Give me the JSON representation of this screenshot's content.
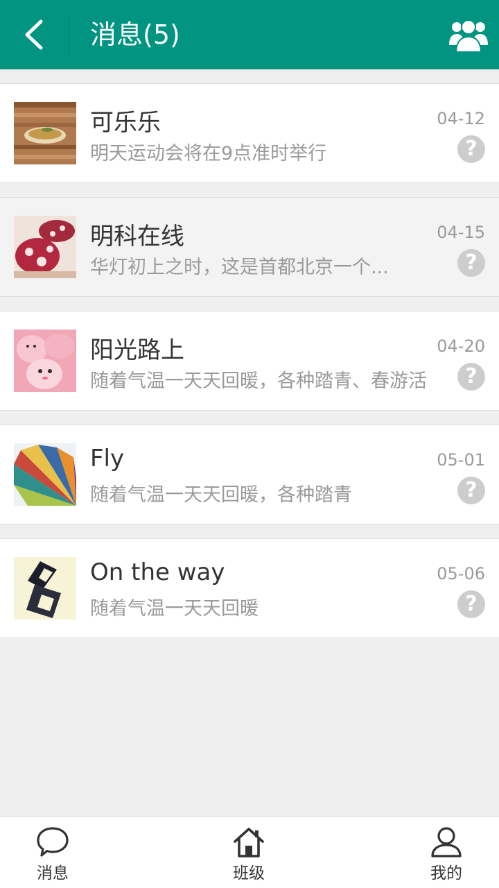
{
  "header": {
    "title": "消息(5)",
    "back_icon": "chevron-left-icon",
    "group_icon": "group-icon",
    "bg_color": "#009481"
  },
  "messages": [
    {
      "name": "可乐乐",
      "preview": "明天运动会将在9点准时举行",
      "date": "04-12",
      "status_icon": "question-icon"
    },
    {
      "name": "明科在线",
      "preview": "华灯初上之时，这是首都北京一个...",
      "date": "04-15",
      "status_icon": "question-icon"
    },
    {
      "name": "阳光路上",
      "preview": "随着气温一天天回暖，各种踏青、春游活",
      "date": "04-20",
      "status_icon": "question-icon"
    },
    {
      "name": "Fly",
      "preview": "随着气温一天天回暖，各种踏青",
      "date": "05-01",
      "status_icon": "question-icon"
    },
    {
      "name": "On the way",
      "preview": "随着气温一天天回暖",
      "date": "05-06",
      "status_icon": "question-icon"
    }
  ],
  "tabbar": {
    "tabs": [
      {
        "label": "消息",
        "icon": "chat-bubble-icon"
      },
      {
        "label": "班级",
        "icon": "home-icon"
      },
      {
        "label": "我的",
        "icon": "user-icon"
      }
    ]
  }
}
